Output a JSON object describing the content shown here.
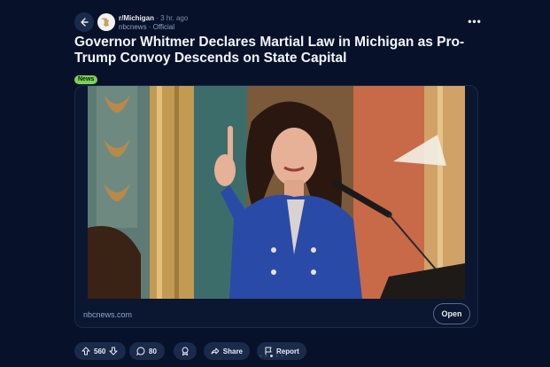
{
  "post": {
    "subreddit": "r/Michigan",
    "separator": "·",
    "time": "3 hr. ago",
    "author": "nbcnews",
    "author_separator": "·",
    "author_badge": "Official",
    "title": "Governor Whitmer Declares Martial Law in Michigan as Pro-Trump Convoy Descends on State Capital",
    "flair": "News",
    "flair_color": "#7bd157"
  },
  "link_card": {
    "domain": "nbcnews.com",
    "open_label": "Open",
    "image_icon": "photo-of-speaker-at-podium"
  },
  "actions": {
    "upvote_icon": "arrow-up-icon",
    "vote_count": "560",
    "downvote_icon": "arrow-down-icon",
    "comment_icon": "comment-icon",
    "comment_count": "80",
    "award_icon": "award-icon",
    "share_icon": "share-icon",
    "share_label": "Share",
    "report_icon": "flag-icon",
    "report_label": "Report"
  },
  "colors": {
    "background": "#07122a",
    "pill": "#1a2a4a",
    "link": "#8fa6cf"
  }
}
